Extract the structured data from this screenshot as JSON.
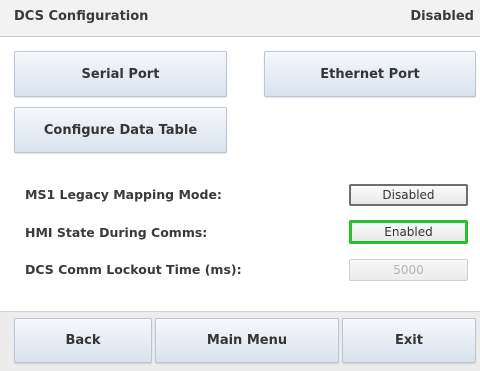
{
  "header": {
    "title": "DCS Configuration",
    "status": "Disabled"
  },
  "buttons": {
    "serial_port": "Serial Port",
    "ethernet_port": "Ethernet Port",
    "configure_data_table": "Configure Data Table"
  },
  "settings": [
    {
      "label": "MS1 Legacy Mapping Mode:",
      "value": "Disabled",
      "state": "normal"
    },
    {
      "label": "HMI State During Comms:",
      "value": "Enabled",
      "state": "selected"
    },
    {
      "label": "DCS Comm Lockout Time (ms):",
      "value": "5000",
      "state": "disabled"
    }
  ],
  "footer": {
    "back": "Back",
    "main_menu": "Main Menu",
    "exit": "Exit"
  },
  "colors": {
    "selected_border": "#27c227",
    "button_top": "#f6f8fb",
    "button_bottom": "#d9e2ec"
  }
}
